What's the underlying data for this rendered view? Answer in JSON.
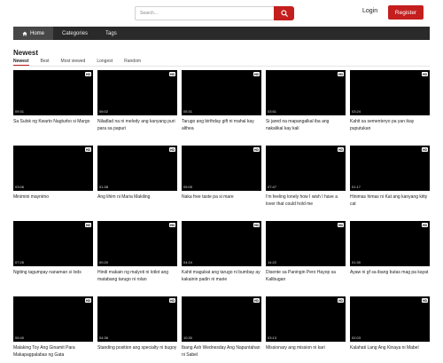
{
  "header": {
    "search_placeholder": "Search...",
    "login_label": "Login",
    "register_label": "Register",
    "accent": "#c41e1e"
  },
  "nav": {
    "items": [
      {
        "label": "Home",
        "icon": "home-icon",
        "active": true
      },
      {
        "label": "Categories",
        "active": false
      },
      {
        "label": "Tags",
        "active": false
      }
    ]
  },
  "main": {
    "title": "Newest",
    "sort": [
      "Newest",
      "Best",
      "Most viewed",
      "Longest",
      "Random"
    ],
    "videos": [
      {
        "title": "Sa Sulok ng Kwarto Nagturbo si Margo",
        "duration": "09:31",
        "badge": "HD"
      },
      {
        "title": "Niladlad na ni melody ang kanyang puri para sa papuri",
        "duration": "06:02",
        "badge": "HD"
      },
      {
        "title": "Tarugo ang birthday gift ni mahal kay althea",
        "duration": "05:31",
        "badge": "HD"
      },
      {
        "title": "Si jared na mapangalkal iba ang nakalikal kay kali",
        "duration": "03:51",
        "badge": "HD"
      },
      {
        "title": "Kahit sa sementeryo pa yan ikay puputukan",
        "duration": "03:24",
        "badge": "HD"
      },
      {
        "title": "Minimini maynimo",
        "duration": "03:06",
        "badge": "HD"
      },
      {
        "title": "Ang lihim ni Maria Makiling",
        "duration": "01:38",
        "badge": "HD"
      },
      {
        "title": "Naka free taste pa si mare",
        "duration": "05:05",
        "badge": "HD"
      },
      {
        "title": "I'm feeling lonely how I wish I have a lover that could hold me",
        "duration": "07:47",
        "badge": "HD"
      },
      {
        "title": "Hinimas himas ni Kat ang kanyang kitty cat",
        "duration": "01:17",
        "badge": "HD"
      },
      {
        "title": "Ngiting tagumpay nanaman si lods",
        "duration": "07:26",
        "badge": "HD"
      },
      {
        "title": "Hindi makain ng malyoti ni lotlot ang matabang tarugo ni rolan",
        "duration": "00:20",
        "badge": "HD"
      },
      {
        "title": "Kahit magubat ang tarugo ni bumbay ay kakainin padin ni marie",
        "duration": "04:24",
        "badge": "HD"
      },
      {
        "title": "Disente sa Paningin Pero Hayop sa Kalibugan",
        "duration": "14:22",
        "badge": "HD"
      },
      {
        "title": "Ayaw ni gf sa ibang butas mag pa kayat",
        "duration": "01:30",
        "badge": "HD"
      },
      {
        "title": "Malaking Toy Ang Ginamit Para Makapagpalabas ng Gata",
        "duration": "06:40",
        "badge": "HD"
      },
      {
        "title": "Standing position ang specialty ni bugoy",
        "duration": "04:36",
        "badge": "HD"
      },
      {
        "title": "Ibang Ash Wednesday Ang Napuntahan ni Sabel",
        "duration": "10:30",
        "badge": "HD"
      },
      {
        "title": "Missionary ang mission ni kari",
        "duration": "03:13",
        "badge": "HD"
      },
      {
        "title": "Kalahati Lang Ang Kinaya ni Mabel",
        "duration": "02:03",
        "badge": "HD"
      }
    ]
  }
}
